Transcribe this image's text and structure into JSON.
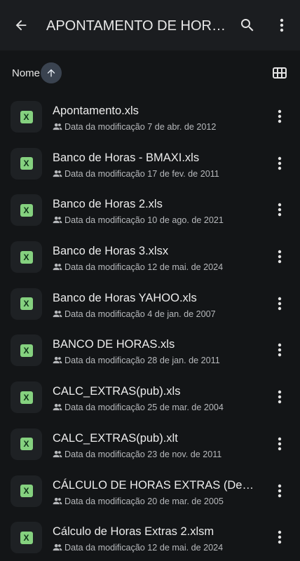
{
  "header": {
    "title": "APONTAMENTO DE HORAS EXTRAS",
    "back_icon": "arrow-back-icon",
    "search_icon": "search-icon",
    "more_icon": "more-vert-icon"
  },
  "sort": {
    "label": "Nome",
    "direction_icon": "arrow-up-icon",
    "view_icon": "grid-view-icon"
  },
  "colors": {
    "background": "#131517",
    "appbar": "#1b1d20",
    "excel_badge": "#85d17f",
    "sort_chip": "#3a4350"
  },
  "files": [
    {
      "name": "Apontamento.xls",
      "meta": "Data da modificação 7 de abr. de 2012",
      "icon": "excel-icon"
    },
    {
      "name": "Banco de Horas - BMAXI.xls",
      "meta": "Data da modificação 17 de fev. de 2011",
      "icon": "excel-icon"
    },
    {
      "name": "Banco de Horas 2.xls",
      "meta": "Data da modificação 10 de ago. de 2021",
      "icon": "excel-icon"
    },
    {
      "name": "Banco de Horas 3.xlsx",
      "meta": "Data da modificação 12 de mai. de 2024",
      "icon": "excel-icon"
    },
    {
      "name": "Banco de Horas YAHOO.xls",
      "meta": "Data da modificação 4 de jan. de 2007",
      "icon": "excel-icon"
    },
    {
      "name": "BANCO DE HORAS.xls",
      "meta": "Data da modificação 28 de jan. de 2011",
      "icon": "excel-icon"
    },
    {
      "name": "CALC_EXTRAS(pub).xls",
      "meta": "Data da modificação 25 de mar. de 2004",
      "icon": "excel-icon"
    },
    {
      "name": "CALC_EXTRAS(pub).xlt",
      "meta": "Data da modificação 23 de nov. de 2011",
      "icon": "excel-icon"
    },
    {
      "name": "CÁLCULO DE HORAS EXTRAS (Demonstração).xls",
      "meta": "Data da modificação 20 de mar. de 2005",
      "icon": "excel-icon"
    },
    {
      "name": "Cálculo de Horas Extras 2.xlsm",
      "meta": "Data da modificação 12 de mai. de 2024",
      "icon": "excel-icon"
    }
  ]
}
